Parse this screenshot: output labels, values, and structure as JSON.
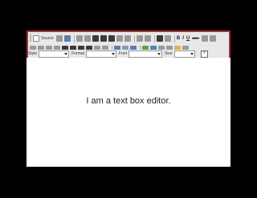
{
  "toolbar": {
    "source_label": "Source",
    "style_label": "Style",
    "format_label": "Format",
    "font_label": "Font",
    "size_label": "Size",
    "bold_glyph": "B",
    "italic_glyph": "I",
    "underline_glyph": "U",
    "strike_glyph": "ABC",
    "help_glyph": "?"
  },
  "editor": {
    "content_text": "I am a text box editor."
  },
  "colors": {
    "highlight_border": "#c8232c",
    "toolbar_bg": "#e8e8e8",
    "page_bg": "#000000"
  }
}
